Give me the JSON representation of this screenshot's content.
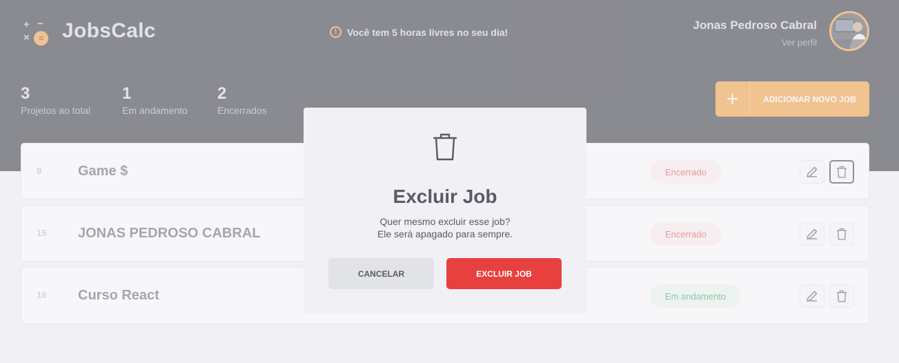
{
  "header": {
    "brand": "JobsCalc",
    "notice": "Você tem 5 horas livres no seu dia!",
    "user": {
      "name": "Jonas Pedroso Cabral",
      "profile_link": "Ver perfil"
    }
  },
  "summary": {
    "total": {
      "value": "3",
      "label": "Projetos ao total"
    },
    "in_progress": {
      "value": "1",
      "label": "Em andamento"
    },
    "closed": {
      "value": "2",
      "label": "Encerrados"
    },
    "add_button": "ADICIONAR NOVO JOB"
  },
  "jobs": [
    {
      "id": "9",
      "name": "Game $",
      "status": "Encerrado"
    },
    {
      "id": "15",
      "name": "JONAS PEDROSO CABRAL",
      "status": "Encerrado"
    },
    {
      "id": "16",
      "name": "Curso React",
      "status": "Em andamento"
    }
  ],
  "modal": {
    "title": "Excluir Job",
    "line1": "Quer mesmo excluir esse job?",
    "line2": "Ele será apagado para sempre.",
    "cancel": "CANCELAR",
    "confirm": "EXCLUIR JOB"
  },
  "colors": {
    "header_bg": "#25252D",
    "accent_orange": "#F1972C",
    "danger_red": "#E83F3F",
    "success_green": "#2E9D4E",
    "page_bg": "#F0F0F5"
  },
  "icons": [
    "calculator-logo-icon",
    "warning-icon",
    "plus-icon",
    "edit-icon",
    "trash-icon"
  ]
}
